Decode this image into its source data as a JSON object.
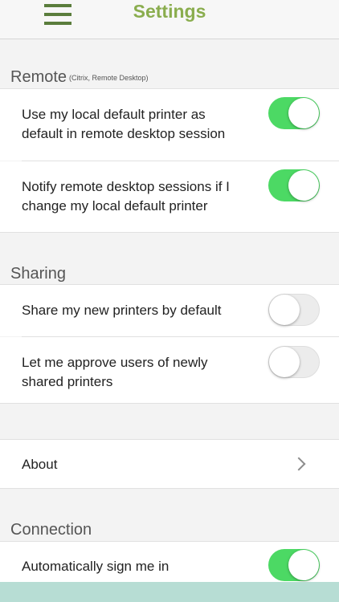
{
  "header": {
    "title": "Settings",
    "menu_icon": "hamburger-menu-icon"
  },
  "sections": {
    "remote": {
      "title": "Remote",
      "subtitle": "(Citrix, Remote Desktop)",
      "items": [
        {
          "label_line1": "Use my local default printer as",
          "label_line2": "default in remote desktop session",
          "toggle": true
        },
        {
          "label_line1": "Notify remote desktop sessions if I",
          "label_line2": "change my local default printer",
          "toggle": true
        }
      ]
    },
    "sharing": {
      "title": "Sharing",
      "items": [
        {
          "label": "Share my new printers by default",
          "toggle": false
        },
        {
          "label_line1": "Let me approve users of newly",
          "label_line2": "shared printers",
          "toggle": false
        }
      ]
    },
    "about": {
      "label": "About",
      "icon": "chevron-right-icon"
    },
    "connection": {
      "title": "Connection",
      "items": [
        {
          "label": "Automatically sign me in",
          "toggle": true
        }
      ]
    }
  },
  "colors": {
    "title": "#8aad4e",
    "menu": "#5a7d3c",
    "toggle_on": "#4cd964",
    "toggle_off": "#ececec",
    "bottom_bar": "#b7ddd4"
  }
}
